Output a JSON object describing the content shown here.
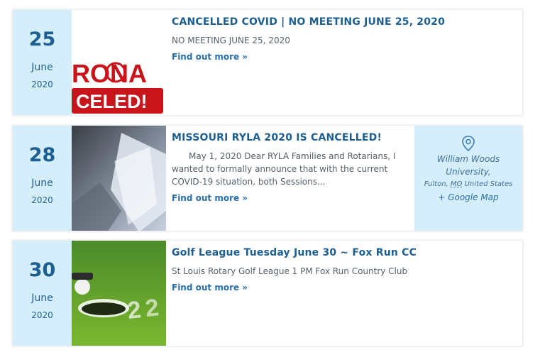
{
  "events": [
    {
      "day": "25",
      "month": "June",
      "year": "2020",
      "title": "CANCELLED COVID | NO MEETING JUNE 25, 2020",
      "excerpt": "NO MEETING  JUNE 25, 2020",
      "more": "Find out more »",
      "image_text_top": "RONA",
      "image_text_bottom": "CELED!"
    },
    {
      "day": "28",
      "month": "June",
      "year": "2020",
      "title": "MISSOURI RYLA 2020 IS CANCELLED!",
      "excerpt": "May 1, 2020 Dear RYLA Families and Rotarians, I wanted to formally announce that with the current COVID-19 situation, both Sessions...",
      "more": "Find out more »",
      "venue": {
        "name": "William Woods University,",
        "city": "Fulton,",
        "state": "MO",
        "country": "United States",
        "map_link": "+ Google Map"
      }
    },
    {
      "day": "30",
      "month": "June",
      "year": "2020",
      "title": "Golf League Tuesday June 30 ~ Fox Run CC",
      "excerpt": "St Louis Rotary Golf League 1 PM Fox Run Country Club",
      "more": "Find out more »"
    }
  ],
  "colors": {
    "accent": "#1e5f92",
    "datebox_bg": "#d5eefb",
    "banner_red": "#c8151b"
  }
}
